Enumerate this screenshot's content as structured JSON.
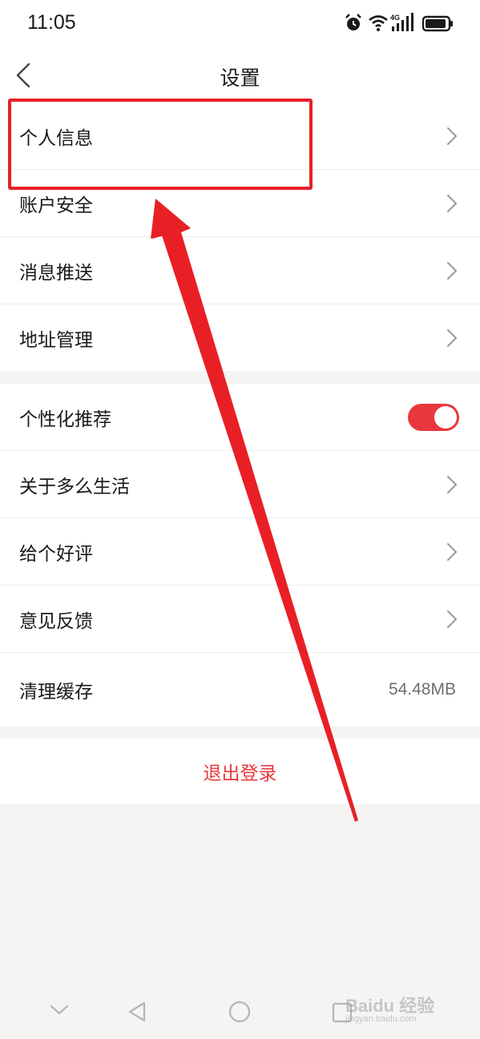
{
  "status_bar": {
    "time": "11:05",
    "network_label": "4G",
    "icons": [
      "alarm-icon",
      "wifi-icon",
      "cellular-signal-icon",
      "battery-icon"
    ]
  },
  "nav": {
    "title": "设置",
    "back_icon": "chevron-left-icon"
  },
  "group1": {
    "items": [
      {
        "label": "个人信息",
        "control": "chevron"
      },
      {
        "label": "账户安全",
        "control": "chevron"
      },
      {
        "label": "消息推送",
        "control": "chevron"
      },
      {
        "label": "地址管理",
        "control": "chevron"
      }
    ]
  },
  "group2": {
    "items": [
      {
        "label": "个性化推荐",
        "control": "toggle",
        "toggle_on": true
      },
      {
        "label": "关于多么生活",
        "control": "chevron"
      },
      {
        "label": "给个好评",
        "control": "chevron"
      },
      {
        "label": "意见反馈",
        "control": "chevron"
      },
      {
        "label": "清理缓存",
        "control": "value",
        "value": "54.48MB"
      }
    ]
  },
  "logout": {
    "label": "退出登录"
  },
  "system_nav": {
    "icons": [
      "chevron-down-icon",
      "back-triangle-icon",
      "home-circle-icon",
      "recents-square-icon"
    ]
  },
  "watermark": {
    "brand": "Baidu 经验",
    "sub": "jingyan.baidu.com"
  },
  "colors": {
    "accent": "#e8383d",
    "annotation": "#e82026",
    "background": "#f5f4f2",
    "divider": "#ececec"
  }
}
